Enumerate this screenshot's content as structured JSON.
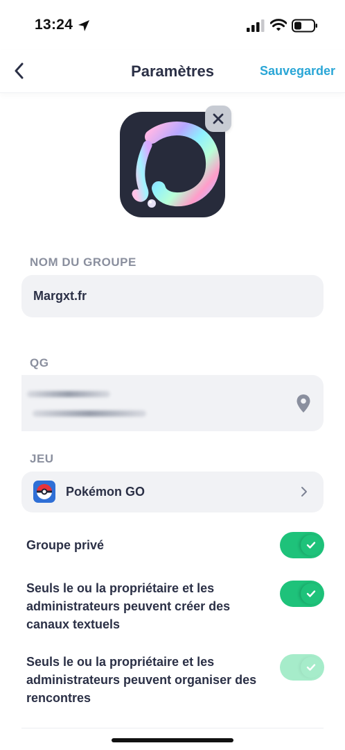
{
  "status_bar": {
    "time": "13:24"
  },
  "header": {
    "title": "Paramètres",
    "save_label": "Sauvegarder"
  },
  "group_name": {
    "label": "NOM DU GROUPE",
    "value": "Margxt.fr"
  },
  "hq": {
    "label": "QG"
  },
  "game": {
    "label": "JEU",
    "value": "Pokémon GO"
  },
  "toggles": [
    {
      "label": "Groupe privé",
      "on": true
    },
    {
      "label": "Seuls le ou la propriétaire et les administrateurs peuvent créer des canaux textuels",
      "on": true
    },
    {
      "label": "Seuls le ou la propriétaire et les administrateurs peuvent organiser des rencontres",
      "on": true
    }
  ],
  "colors": {
    "accent": "#2aa6d6",
    "toggle_on": "#1ec27a",
    "toggle_disabled": "#a6ecca",
    "field_bg": "#f1f2f5"
  }
}
